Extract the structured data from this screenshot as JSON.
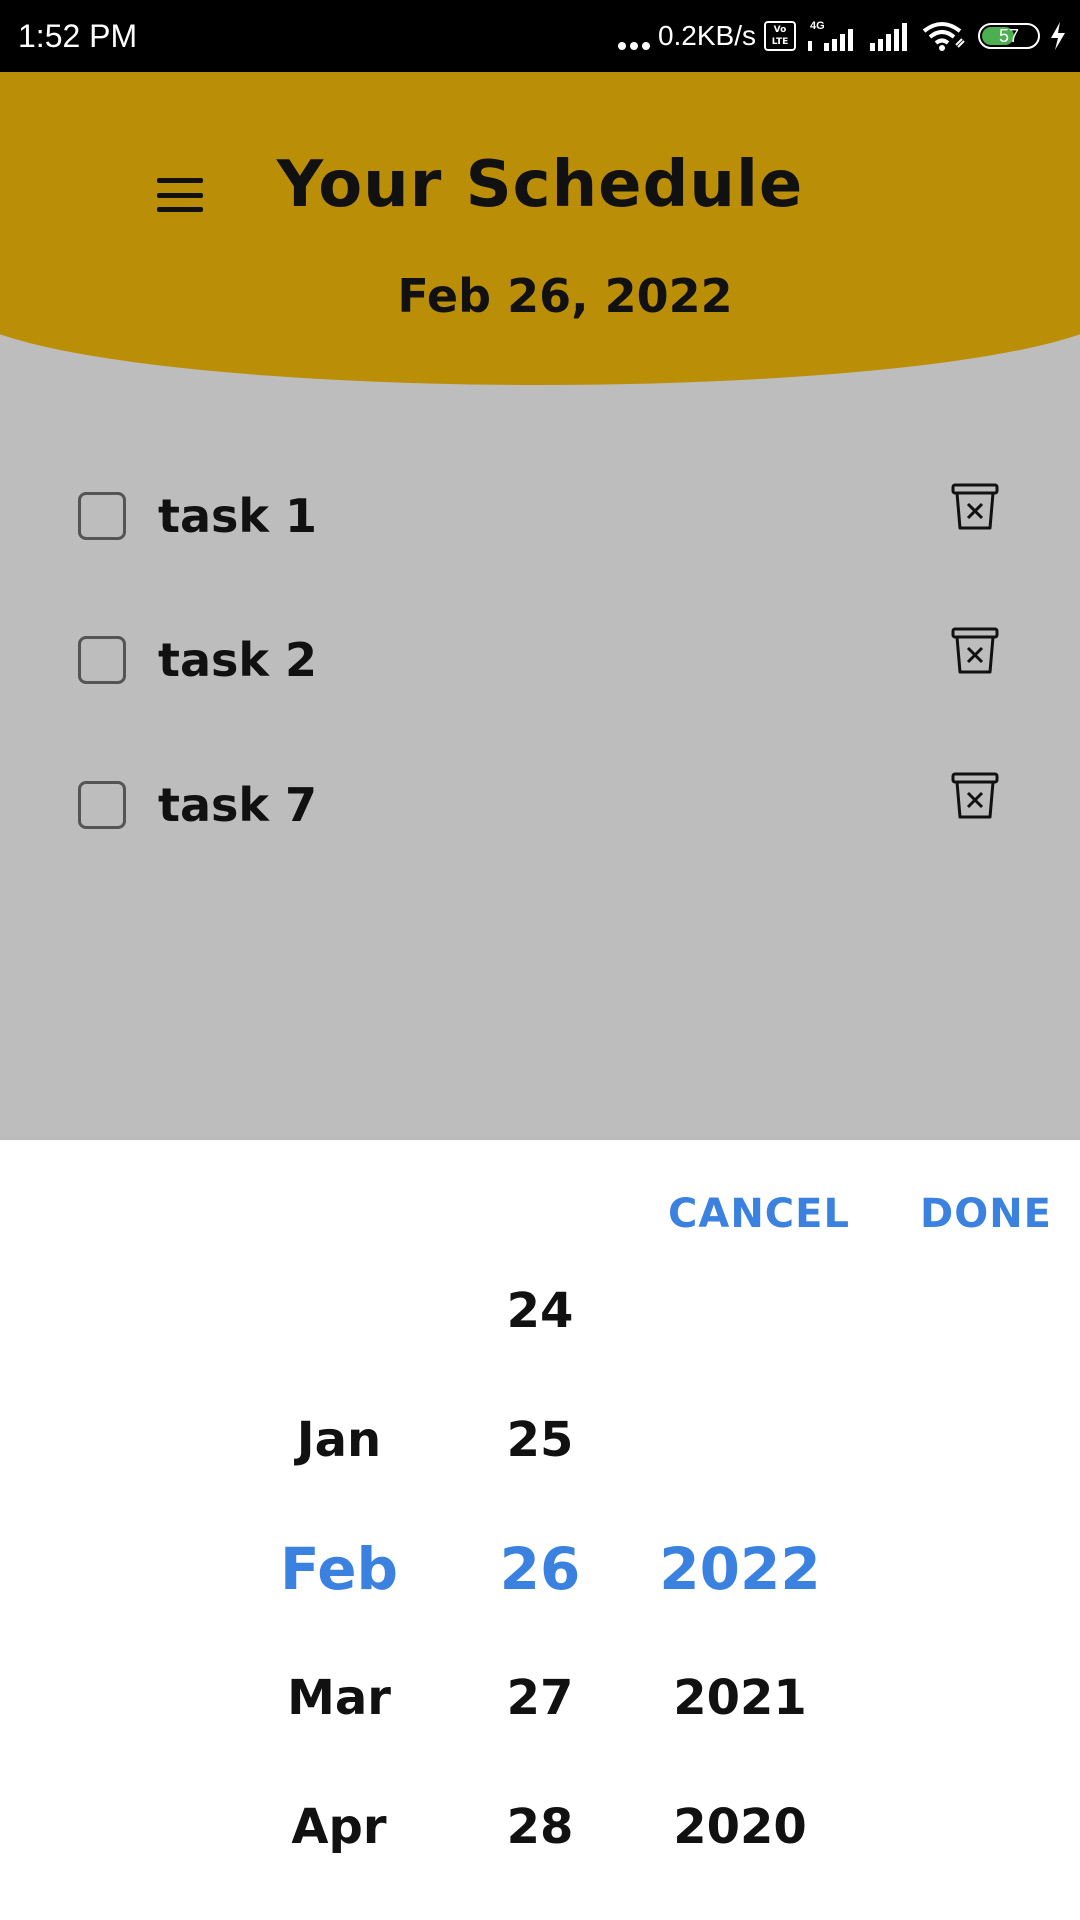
{
  "status_bar": {
    "time": "1:52 PM",
    "network_speed": "0.2KB/s",
    "volte_label": "Vo LTE",
    "network_type": "4G",
    "battery_level": "57"
  },
  "header": {
    "title": "Your Schedule",
    "date": "Feb 26, 2022",
    "background_color": "#bb8e08"
  },
  "tasks": [
    {
      "label": "task 1",
      "checked": false
    },
    {
      "label": "task 2",
      "checked": false
    },
    {
      "label": "task 7",
      "checked": false
    }
  ],
  "date_picker": {
    "cancel_label": "CANCEL",
    "done_label": "DONE",
    "accent_color": "#3b82e0",
    "months": [
      "Jan",
      "Feb",
      "Mar",
      "Apr"
    ],
    "days": [
      "24",
      "25",
      "26",
      "27",
      "28"
    ],
    "years": [
      "2022",
      "2021",
      "2020"
    ],
    "selected": {
      "month": "Feb",
      "day": "26",
      "year": "2022"
    }
  },
  "icons": {
    "menu": "hamburger-menu-icon",
    "delete": "trash-icon"
  }
}
